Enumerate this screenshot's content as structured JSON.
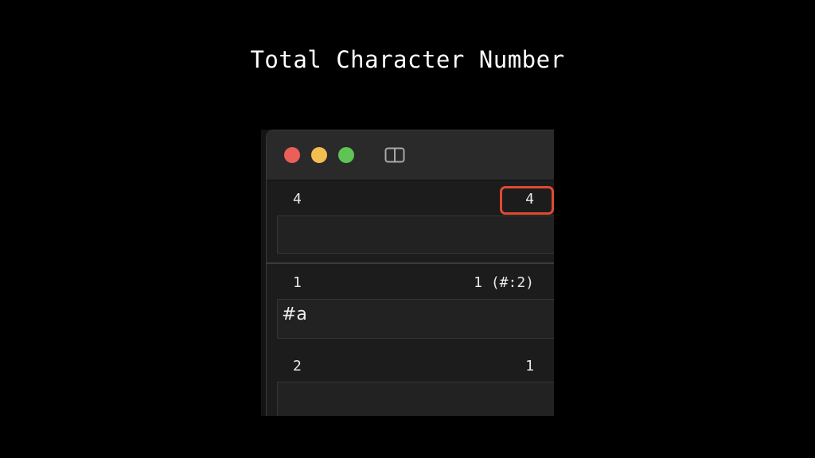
{
  "slide": {
    "title": "Total Character Number"
  },
  "window": {
    "sidebar_icon": "sidebar-toggle-icon",
    "rows": [
      {
        "index": "4",
        "count": "4",
        "text": ""
      },
      {
        "index": "1",
        "count": "1 (#:2)",
        "text": "#a"
      },
      {
        "index": "2",
        "count": "1",
        "text": ""
      }
    ]
  },
  "colors": {
    "background": "#000000",
    "highlight": "#e04a32",
    "close": "#ec5f59",
    "minimize": "#f4bd4f",
    "zoom": "#5fc453"
  }
}
